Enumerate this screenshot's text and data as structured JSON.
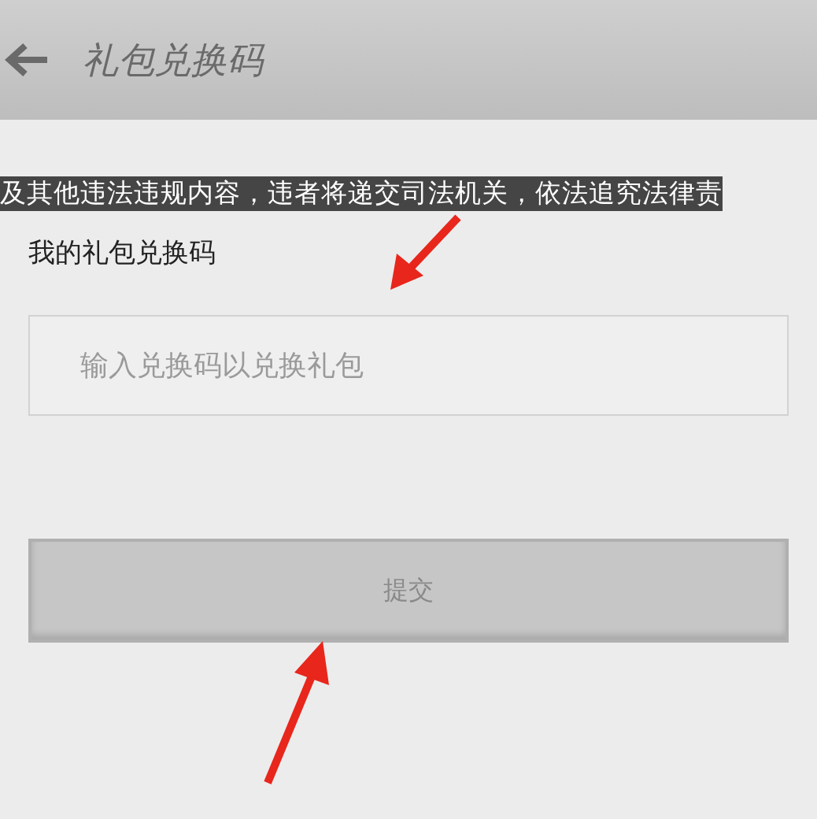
{
  "header": {
    "title": "礼包兑换码"
  },
  "notice": "及其他违法违规内容，违者将递交司法机关，依法追究法律责",
  "section_title": "我的礼包兑换码",
  "code_field": {
    "placeholder": "输入兑换码以兑换礼包"
  },
  "submit_button": {
    "label": "提交",
    "disabled": true
  }
}
